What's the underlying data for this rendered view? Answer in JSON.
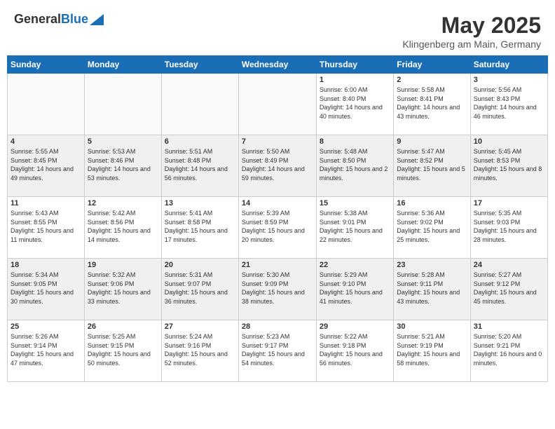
{
  "header": {
    "logo_general": "General",
    "logo_blue": "Blue",
    "month_title": "May 2025",
    "location": "Klingenberg am Main, Germany"
  },
  "weekdays": [
    "Sunday",
    "Monday",
    "Tuesday",
    "Wednesday",
    "Thursday",
    "Friday",
    "Saturday"
  ],
  "weeks": [
    [
      {
        "day": "",
        "sunrise": "",
        "sunset": "",
        "daylight": "",
        "empty": true
      },
      {
        "day": "",
        "sunrise": "",
        "sunset": "",
        "daylight": "",
        "empty": true
      },
      {
        "day": "",
        "sunrise": "",
        "sunset": "",
        "daylight": "",
        "empty": true
      },
      {
        "day": "",
        "sunrise": "",
        "sunset": "",
        "daylight": "",
        "empty": true
      },
      {
        "day": "1",
        "sunrise": "Sunrise: 6:00 AM",
        "sunset": "Sunset: 8:40 PM",
        "daylight": "Daylight: 14 hours and 40 minutes."
      },
      {
        "day": "2",
        "sunrise": "Sunrise: 5:58 AM",
        "sunset": "Sunset: 8:41 PM",
        "daylight": "Daylight: 14 hours and 43 minutes."
      },
      {
        "day": "3",
        "sunrise": "Sunrise: 5:56 AM",
        "sunset": "Sunset: 8:43 PM",
        "daylight": "Daylight: 14 hours and 46 minutes."
      }
    ],
    [
      {
        "day": "4",
        "sunrise": "Sunrise: 5:55 AM",
        "sunset": "Sunset: 8:45 PM",
        "daylight": "Daylight: 14 hours and 49 minutes."
      },
      {
        "day": "5",
        "sunrise": "Sunrise: 5:53 AM",
        "sunset": "Sunset: 8:46 PM",
        "daylight": "Daylight: 14 hours and 53 minutes."
      },
      {
        "day": "6",
        "sunrise": "Sunrise: 5:51 AM",
        "sunset": "Sunset: 8:48 PM",
        "daylight": "Daylight: 14 hours and 56 minutes."
      },
      {
        "day": "7",
        "sunrise": "Sunrise: 5:50 AM",
        "sunset": "Sunset: 8:49 PM",
        "daylight": "Daylight: 14 hours and 59 minutes."
      },
      {
        "day": "8",
        "sunrise": "Sunrise: 5:48 AM",
        "sunset": "Sunset: 8:50 PM",
        "daylight": "Daylight: 15 hours and 2 minutes."
      },
      {
        "day": "9",
        "sunrise": "Sunrise: 5:47 AM",
        "sunset": "Sunset: 8:52 PM",
        "daylight": "Daylight: 15 hours and 5 minutes."
      },
      {
        "day": "10",
        "sunrise": "Sunrise: 5:45 AM",
        "sunset": "Sunset: 8:53 PM",
        "daylight": "Daylight: 15 hours and 8 minutes."
      }
    ],
    [
      {
        "day": "11",
        "sunrise": "Sunrise: 5:43 AM",
        "sunset": "Sunset: 8:55 PM",
        "daylight": "Daylight: 15 hours and 11 minutes."
      },
      {
        "day": "12",
        "sunrise": "Sunrise: 5:42 AM",
        "sunset": "Sunset: 8:56 PM",
        "daylight": "Daylight: 15 hours and 14 minutes."
      },
      {
        "day": "13",
        "sunrise": "Sunrise: 5:41 AM",
        "sunset": "Sunset: 8:58 PM",
        "daylight": "Daylight: 15 hours and 17 minutes."
      },
      {
        "day": "14",
        "sunrise": "Sunrise: 5:39 AM",
        "sunset": "Sunset: 8:59 PM",
        "daylight": "Daylight: 15 hours and 20 minutes."
      },
      {
        "day": "15",
        "sunrise": "Sunrise: 5:38 AM",
        "sunset": "Sunset: 9:01 PM",
        "daylight": "Daylight: 15 hours and 22 minutes."
      },
      {
        "day": "16",
        "sunrise": "Sunrise: 5:36 AM",
        "sunset": "Sunset: 9:02 PM",
        "daylight": "Daylight: 15 hours and 25 minutes."
      },
      {
        "day": "17",
        "sunrise": "Sunrise: 5:35 AM",
        "sunset": "Sunset: 9:03 PM",
        "daylight": "Daylight: 15 hours and 28 minutes."
      }
    ],
    [
      {
        "day": "18",
        "sunrise": "Sunrise: 5:34 AM",
        "sunset": "Sunset: 9:05 PM",
        "daylight": "Daylight: 15 hours and 30 minutes."
      },
      {
        "day": "19",
        "sunrise": "Sunrise: 5:32 AM",
        "sunset": "Sunset: 9:06 PM",
        "daylight": "Daylight: 15 hours and 33 minutes."
      },
      {
        "day": "20",
        "sunrise": "Sunrise: 5:31 AM",
        "sunset": "Sunset: 9:07 PM",
        "daylight": "Daylight: 15 hours and 36 minutes."
      },
      {
        "day": "21",
        "sunrise": "Sunrise: 5:30 AM",
        "sunset": "Sunset: 9:09 PM",
        "daylight": "Daylight: 15 hours and 38 minutes."
      },
      {
        "day": "22",
        "sunrise": "Sunrise: 5:29 AM",
        "sunset": "Sunset: 9:10 PM",
        "daylight": "Daylight: 15 hours and 41 minutes."
      },
      {
        "day": "23",
        "sunrise": "Sunrise: 5:28 AM",
        "sunset": "Sunset: 9:11 PM",
        "daylight": "Daylight: 15 hours and 43 minutes."
      },
      {
        "day": "24",
        "sunrise": "Sunrise: 5:27 AM",
        "sunset": "Sunset: 9:12 PM",
        "daylight": "Daylight: 15 hours and 45 minutes."
      }
    ],
    [
      {
        "day": "25",
        "sunrise": "Sunrise: 5:26 AM",
        "sunset": "Sunset: 9:14 PM",
        "daylight": "Daylight: 15 hours and 47 minutes."
      },
      {
        "day": "26",
        "sunrise": "Sunrise: 5:25 AM",
        "sunset": "Sunset: 9:15 PM",
        "daylight": "Daylight: 15 hours and 50 minutes."
      },
      {
        "day": "27",
        "sunrise": "Sunrise: 5:24 AM",
        "sunset": "Sunset: 9:16 PM",
        "daylight": "Daylight: 15 hours and 52 minutes."
      },
      {
        "day": "28",
        "sunrise": "Sunrise: 5:23 AM",
        "sunset": "Sunset: 9:17 PM",
        "daylight": "Daylight: 15 hours and 54 minutes."
      },
      {
        "day": "29",
        "sunrise": "Sunrise: 5:22 AM",
        "sunset": "Sunset: 9:18 PM",
        "daylight": "Daylight: 15 hours and 56 minutes."
      },
      {
        "day": "30",
        "sunrise": "Sunrise: 5:21 AM",
        "sunset": "Sunset: 9:19 PM",
        "daylight": "Daylight: 15 hours and 58 minutes."
      },
      {
        "day": "31",
        "sunrise": "Sunrise: 5:20 AM",
        "sunset": "Sunset: 9:21 PM",
        "daylight": "Daylight: 16 hours and 0 minutes."
      }
    ]
  ]
}
